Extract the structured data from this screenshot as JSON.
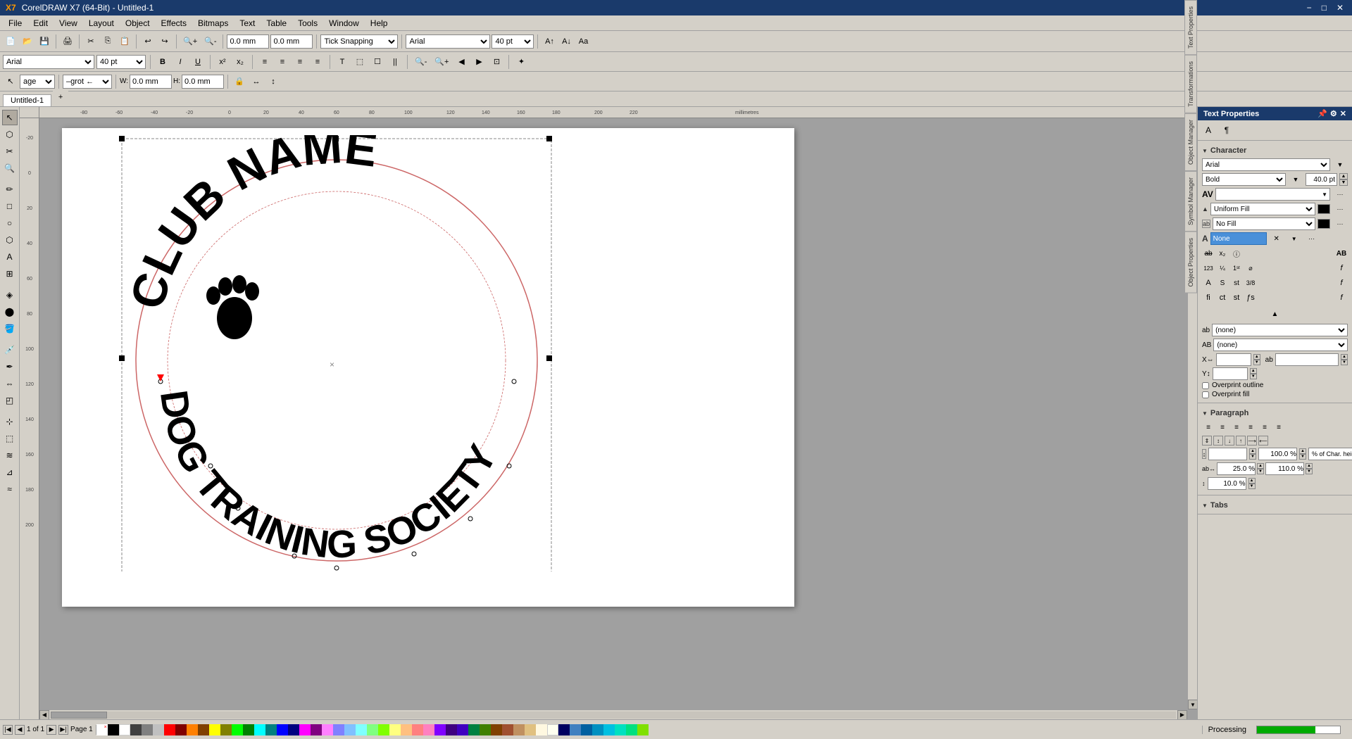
{
  "titlebar": {
    "title": "CorelDRAW X7 (64-Bit) - Untitled-1",
    "minimize": "−",
    "maximize": "□",
    "close": "✕"
  },
  "menubar": {
    "items": [
      "File",
      "Edit",
      "View",
      "Layout",
      "Object",
      "Effects",
      "Bitmaps",
      "Text",
      "Table",
      "Tools",
      "Window",
      "Help"
    ]
  },
  "toolbar1": {
    "items": [
      "new",
      "open",
      "save",
      "print",
      "cut",
      "copy",
      "paste",
      "undo",
      "redo"
    ]
  },
  "toolbar2": {
    "snap_label": "Tick Snapping",
    "font": "Arial",
    "size": "40 pt"
  },
  "text_toolbar": {
    "font": "Arial",
    "size": "40 pt"
  },
  "tabs": {
    "items": [
      "Untitled-1"
    ],
    "active": "Untitled-1",
    "page": "Page 1"
  },
  "canvas": {
    "top_text": "CLUB NAME",
    "bottom_text": "DOG TRAINING SOCIETY"
  },
  "right_panel": {
    "title": "Text Properties",
    "character_section": "Character",
    "font_name": "Arial",
    "font_style": "Bold",
    "font_size": "40.0 pt",
    "fill_type": "Uniform Fill",
    "fill_type2": "No Fill",
    "none_label": "None",
    "overprint_outline": "Overprint outline",
    "overprint_fill": "Overprint fill",
    "paragraph_section": "Paragraph",
    "indent_100": "100.0 %",
    "char_height": "% of Char. height",
    "val_25": "25.0 %",
    "val_110": "110.0 %",
    "val_10": "10.0 %",
    "tabs_section": "Tabs",
    "x_label": "X⇔",
    "y_label": "Y↕",
    "ab_label": "ab"
  },
  "statusbar": {
    "status_text": "Processing",
    "page_info": "1 of 1",
    "page_name": "Page 1"
  },
  "colors": {
    "accent": "#1a3a6b",
    "progress": "#00aa00",
    "circle_stroke": "#cc6666"
  }
}
